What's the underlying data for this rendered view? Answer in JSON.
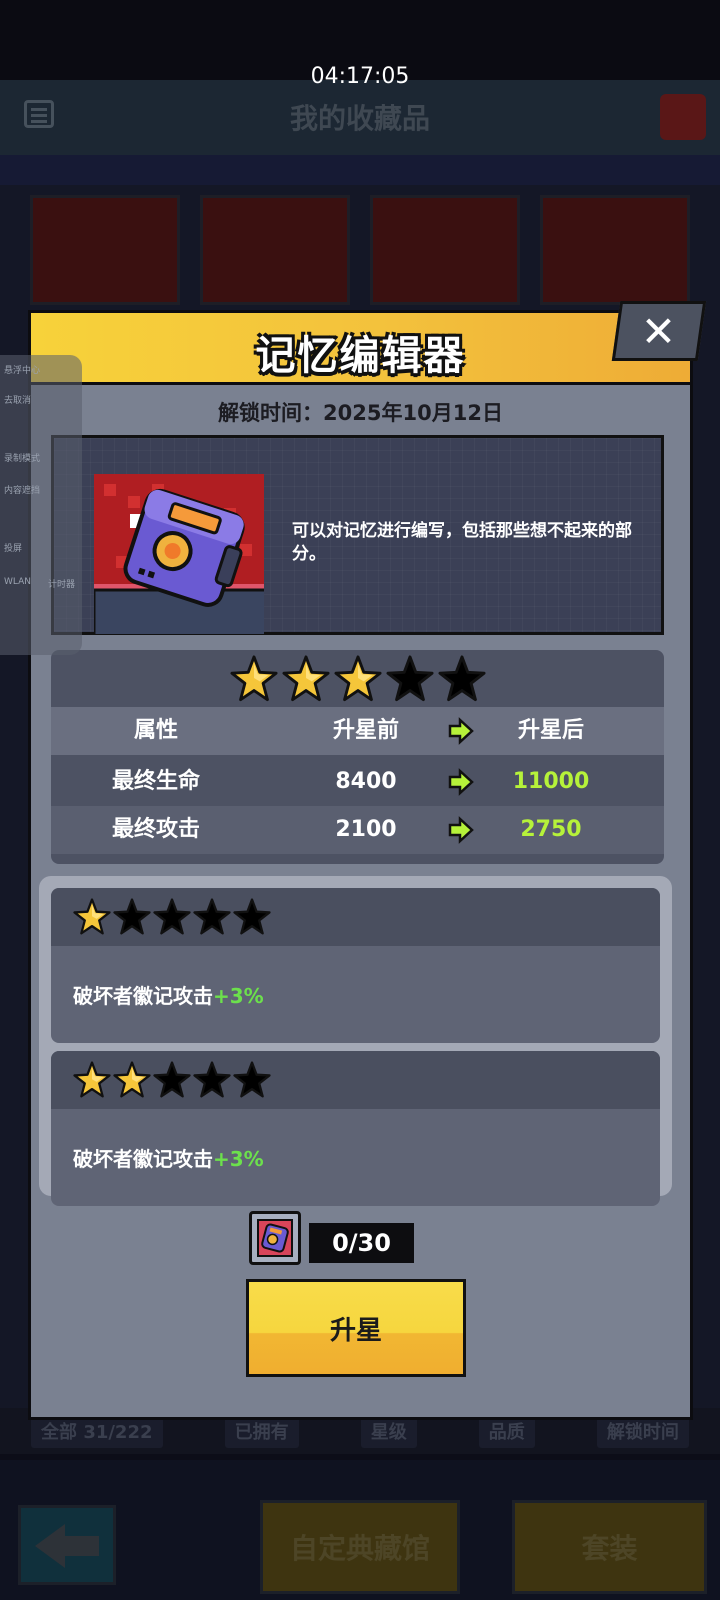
{
  "status_bar": {
    "time": "04:17:05"
  },
  "background": {
    "page_title": "我的收藏品",
    "tabs": [
      "全部 31/222",
      "已拥有",
      "星级",
      "品质",
      "解锁时间"
    ],
    "bottom_buttons": [
      "自定典藏馆",
      "套装"
    ],
    "side_panel": {
      "items": [
        "悬浮中心",
        "去取消",
        "录制模式",
        "内容遮挡",
        "投屏",
        "WLAN",
        "计时器"
      ]
    }
  },
  "modal": {
    "title": "记忆编辑器",
    "close_label": "✕",
    "unlock_date": "解锁时间：2025年10月12日",
    "description": "可以对记忆进行编写，包括那些想不起来的部分。",
    "current_stars": 3,
    "max_stars": 5,
    "stats": {
      "headers": {
        "attribute": "属性",
        "before": "升星前",
        "after": "升星后"
      },
      "rows": [
        {
          "name": "最终生命",
          "before": "8400",
          "after": "11000"
        },
        {
          "name": "最终攻击",
          "before": "2100",
          "after": "2750"
        }
      ]
    },
    "levels": [
      {
        "stars": 1,
        "effect": "破坏者徽记攻击",
        "bonus": "+3%"
      },
      {
        "stars": 2,
        "effect": "破坏者徽记攻击",
        "bonus": "+3%"
      }
    ],
    "cost": {
      "count": "0/30",
      "icon": "memory-editor-device-icon"
    },
    "upgrade_label": "升星"
  },
  "colors": {
    "header_yellow": "#f7d23a",
    "star_gold": "#f5c63a",
    "bonus_green": "#6ce04c",
    "after_value_green": "#b6f23a",
    "button_yellow": "#f6d63e"
  }
}
